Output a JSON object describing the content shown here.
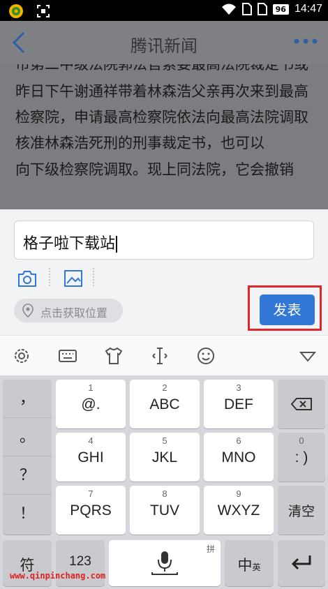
{
  "status_bar": {
    "battery": "96",
    "time": "14:47"
  },
  "nav": {
    "title": "腾讯新闻"
  },
  "article": {
    "paragraphs": [
      "市第二中级法院郭法官索要最高法院裁定书或者复印件，郭法官也拒绝提供。",
      "昨日下午谢通祥带着林森浩父亲再次来到最高检察院，申请最高检察院依法向最高法院调取核准林森浩死刑的刑事裁定书，也可以",
      "向下级检察院调取。现上同法院，它会撤销"
    ]
  },
  "comment": {
    "input_value": "格子啦下载站",
    "location_label": "点击获取位置",
    "publish_label": "发表"
  },
  "keyboard": {
    "symbols": [
      "，",
      "。",
      "？",
      "！"
    ],
    "rows": [
      [
        {
          "num": "1",
          "label": "@."
        },
        {
          "num": "2",
          "label": "ABC"
        },
        {
          "num": "3",
          "label": "DEF"
        }
      ],
      [
        {
          "num": "4",
          "label": "GHI"
        },
        {
          "num": "5",
          "label": "JKL"
        },
        {
          "num": "6",
          "label": "MNO"
        }
      ],
      [
        {
          "num": "7",
          "label": "PQRS"
        },
        {
          "num": "8",
          "label": "TUV"
        },
        {
          "num": "9",
          "label": "WXYZ"
        }
      ]
    ],
    "zero_num": "0",
    "zero_label": ": )",
    "clear_label": "清空",
    "sym_label": "符",
    "num_label": "123",
    "pinyin_label": "拼",
    "lang_label": "中",
    "lang_sub": "英"
  },
  "watermark": "www.qinpinchang.com",
  "colors": {
    "accent": "#3377d6",
    "highlight": "#e0262a"
  }
}
